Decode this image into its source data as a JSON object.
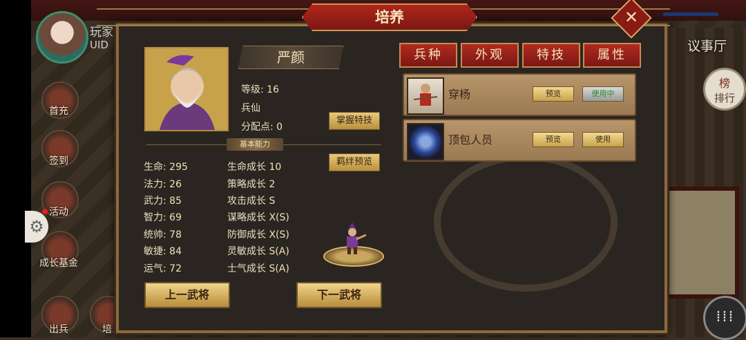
{
  "hud": {
    "player_name": "玩家",
    "player_uid": "UID",
    "left_buttons": [
      {
        "label": "首充"
      },
      {
        "label": "签到"
      },
      {
        "label": "活动"
      },
      {
        "label": "成长基金"
      },
      {
        "label": "出兵"
      },
      {
        "label": "培"
      }
    ],
    "right_top_label": "议事厅",
    "rank_label": "排行",
    "rank_icon_text": "榜"
  },
  "dialog": {
    "title": "培养",
    "general": {
      "name": "严颜",
      "level_label": "等级:",
      "level_value": "16",
      "class": "兵仙",
      "points_label": "分配点:",
      "points_value": "0"
    },
    "buttons": {
      "master_skill": "掌握特技",
      "bond_preview": "羁绊预览",
      "prev_general": "上一武将",
      "next_general": "下一武将"
    },
    "section_title": "基本能力",
    "stats": [
      {
        "label": "生命:",
        "value": "295"
      },
      {
        "label": "法力:",
        "value": "26"
      },
      {
        "label": "武力:",
        "value": "85"
      },
      {
        "label": "智力:",
        "value": "69"
      },
      {
        "label": "统帅:",
        "value": "78"
      },
      {
        "label": "敏捷:",
        "value": "84"
      },
      {
        "label": "运气:",
        "value": "72"
      }
    ],
    "growth": [
      {
        "label": "生命成长",
        "value": "10"
      },
      {
        "label": "策略成长",
        "value": "2"
      },
      {
        "label": "攻击成长",
        "value": "S"
      },
      {
        "label": "谋略成长",
        "value": "X(S)"
      },
      {
        "label": "防御成长",
        "value": "X(S)"
      },
      {
        "label": "灵敏成长",
        "value": "S(A)"
      },
      {
        "label": "士气成长",
        "value": "S(A)"
      }
    ],
    "tabs": [
      "兵种",
      "外观",
      "特技",
      "属性"
    ],
    "units": [
      {
        "name": "穿杨",
        "preview": "预览",
        "action": "使用中",
        "in_use": true
      },
      {
        "name": "顶包人员",
        "preview": "预览",
        "action": "使用",
        "in_use": false
      }
    ]
  }
}
